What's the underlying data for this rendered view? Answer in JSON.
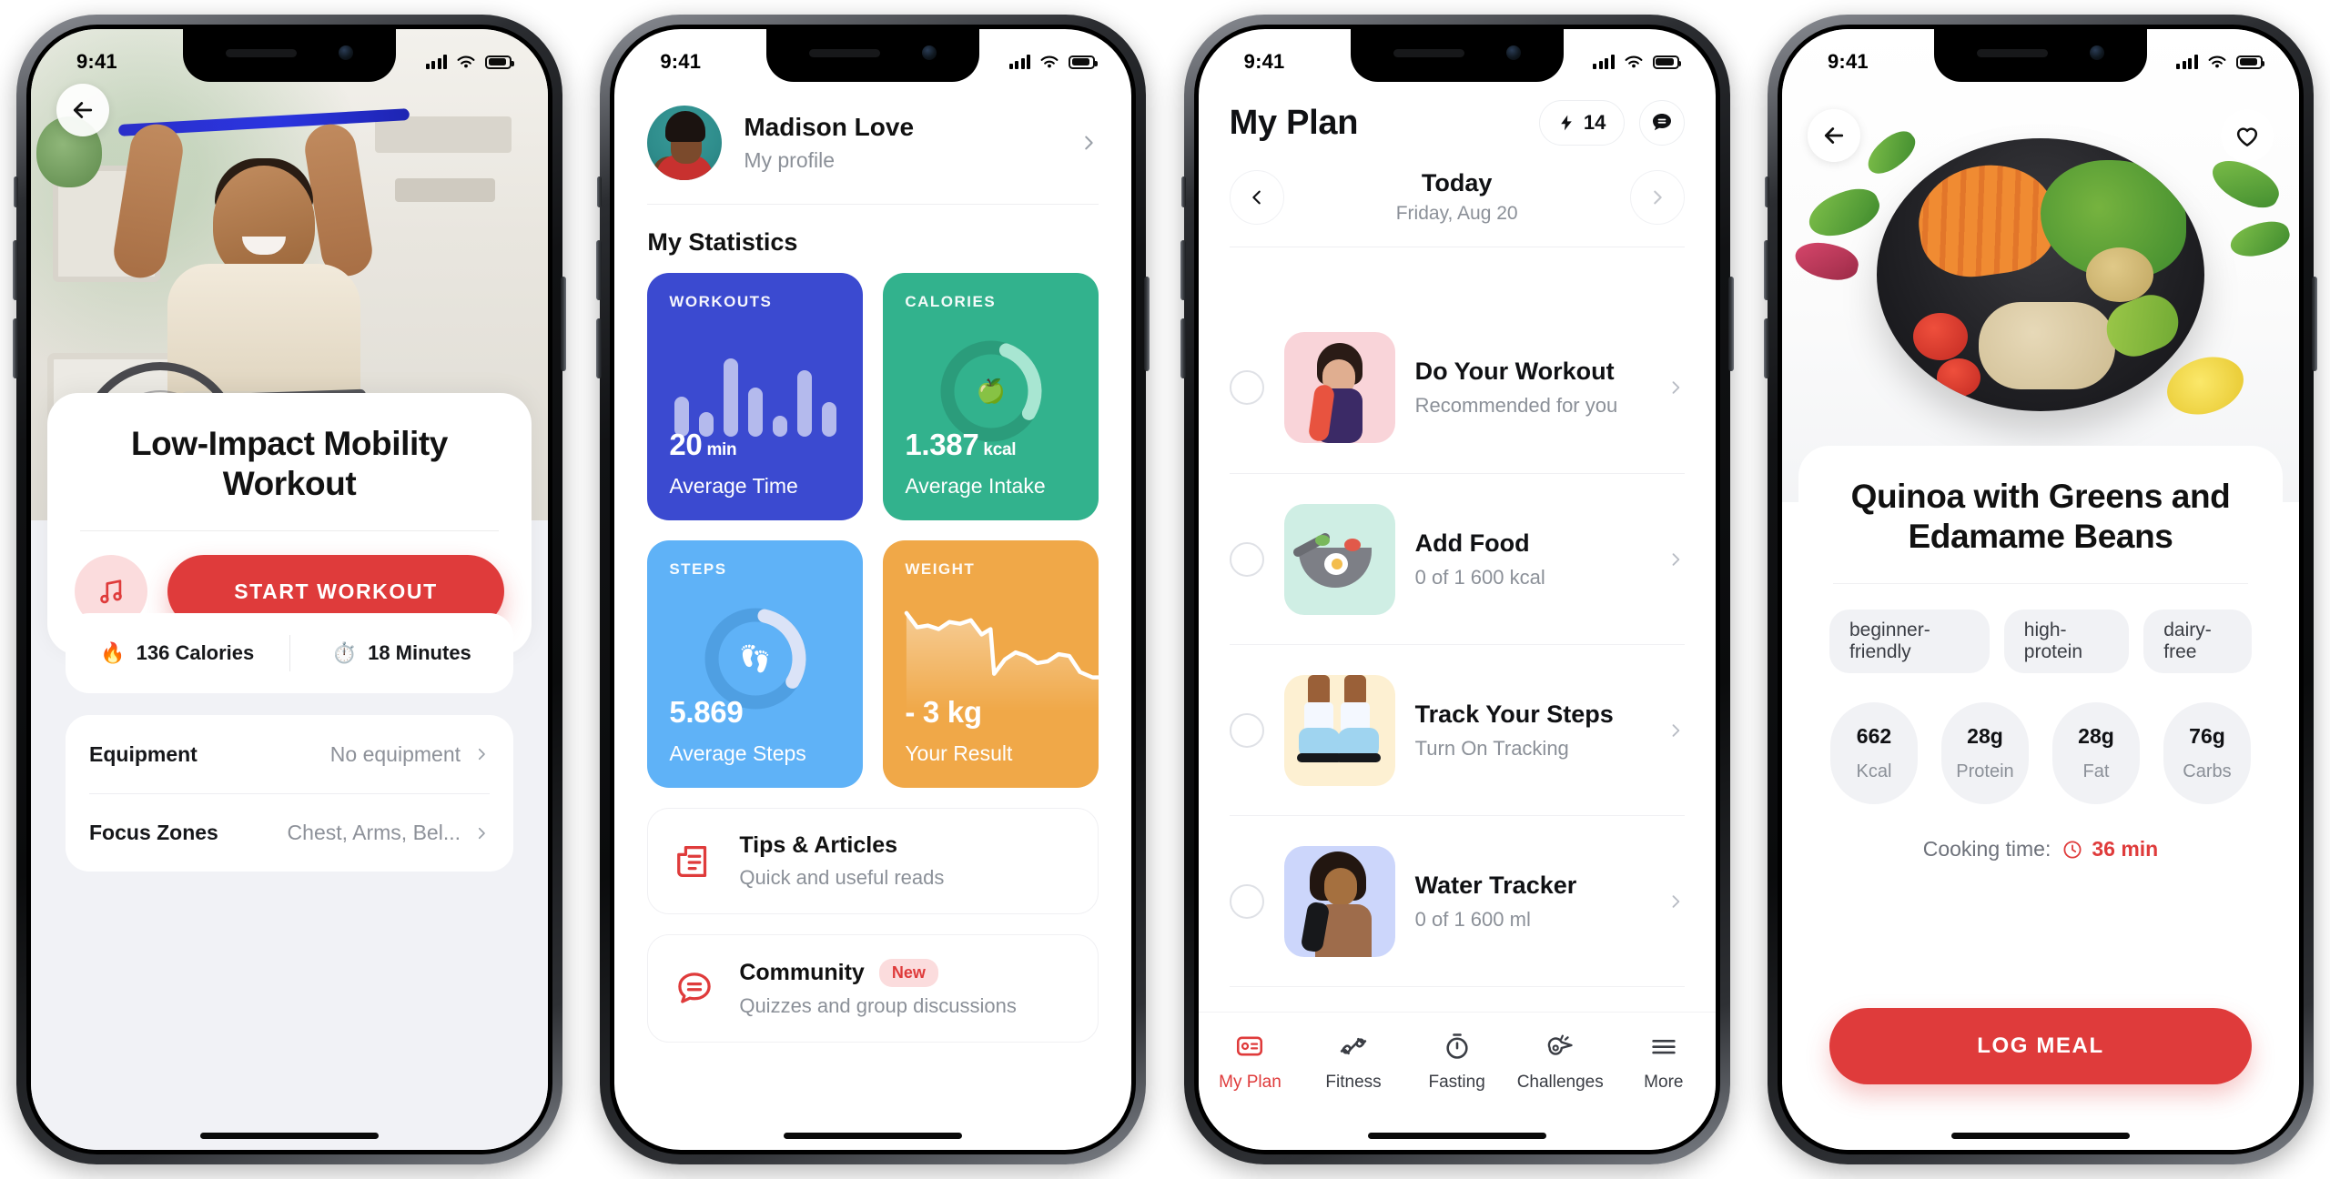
{
  "status_bar": {
    "time": "9:41"
  },
  "phone1": {
    "name": "workout-detail-screen",
    "back_icon": "arrow-left-icon",
    "title": "Low-Impact Mobility Workout",
    "music_icon": "music-note-icon",
    "start_label": "START WORKOUT",
    "stats": [
      {
        "icon": "fire-emoji",
        "glyph": "🔥",
        "text": "136 Calories"
      },
      {
        "icon": "stopwatch-emoji",
        "glyph": "⏱️",
        "text": "18 Minutes"
      }
    ],
    "rows": [
      {
        "label": "Equipment",
        "value": "No equipment"
      },
      {
        "label": "Focus Zones",
        "value": "Chest, Arms, Bel..."
      }
    ]
  },
  "phone2": {
    "name": "profile-statistics-screen",
    "profile": {
      "name": "Madison Love",
      "subtitle": "My profile",
      "chevron": "chevron-right-icon"
    },
    "section_title": "My Statistics",
    "cards": [
      {
        "label": "WORKOUTS",
        "value": "20",
        "unit": "min",
        "caption": "Average Time",
        "color": "#3b4ad0",
        "visual": "bar-chart"
      },
      {
        "label": "CALORIES",
        "value": "1.387",
        "unit": "kcal",
        "caption": "Average Intake",
        "color": "#32b28d",
        "visual": "progress-ring"
      },
      {
        "label": "STEPS",
        "value": "5.869",
        "unit": "",
        "caption": "Average Steps",
        "color": "#5fb2f7",
        "visual": "progress-ring"
      },
      {
        "label": "WEIGHT",
        "value": "- 3 kg",
        "unit": "",
        "caption": "Your Result",
        "color": "#f0a848",
        "visual": "area-line"
      }
    ],
    "links": [
      {
        "icon": "article-icon",
        "title": "Tips & Articles",
        "badge": "",
        "subtitle": "Quick and useful reads"
      },
      {
        "icon": "chat-bubble-icon",
        "title": "Community",
        "badge": "New",
        "subtitle": "Quizzes and group discussions"
      }
    ]
  },
  "phone3": {
    "name": "my-plan-screen",
    "title": "My Plan",
    "streak": {
      "icon": "lightning-bolt-icon",
      "count": "14"
    },
    "chat_icon": "chat-bubble-icon",
    "date_nav": {
      "prev_icon": "chevron-left-icon",
      "next_icon": "chevron-right-icon",
      "day": "Today",
      "date": "Friday, Aug 20"
    },
    "tasks": [
      {
        "title": "Do Your Workout",
        "subtitle": "Recommended for you",
        "thumb": "woman-with-resistance-band",
        "checked": false
      },
      {
        "title": "Add Food",
        "subtitle": "0 of 1 600 kcal",
        "thumb": "frying-pan-with-food",
        "checked": false
      },
      {
        "title": "Track Your Steps",
        "subtitle": "Turn On Tracking",
        "thumb": "sneakers",
        "checked": false
      },
      {
        "title": "Water Tracker",
        "subtitle": "0 of 1 600 ml",
        "thumb": "woman-with-bottle",
        "checked": false
      }
    ],
    "tabs": [
      {
        "label": "My Plan",
        "icon": "plan-card-icon",
        "active": true
      },
      {
        "label": "Fitness",
        "icon": "dumbbell-icon",
        "active": false
      },
      {
        "label": "Fasting",
        "icon": "stopwatch-icon",
        "active": false
      },
      {
        "label": "Challenges",
        "icon": "whistle-icon",
        "active": false
      },
      {
        "label": "More",
        "icon": "hamburger-menu-icon",
        "active": false
      }
    ]
  },
  "phone4": {
    "name": "recipe-detail-screen",
    "back_icon": "arrow-left-icon",
    "favorite_icon": "heart-icon",
    "title": "Quinoa with Greens and Edamame Beans",
    "tags": [
      "beginner-friendly",
      "high-protein",
      "dairy-free"
    ],
    "macros": [
      {
        "value": "662",
        "label": "Kcal"
      },
      {
        "value": "28g",
        "label": "Protein"
      },
      {
        "value": "28g",
        "label": "Fat"
      },
      {
        "value": "76g",
        "label": "Carbs"
      }
    ],
    "cooking_time": {
      "label": "Cooking time:",
      "icon": "clock-icon",
      "value": "36 min"
    },
    "log_label": "LOG MEAL"
  },
  "chart_data": [
    {
      "type": "bar",
      "title": "WORKOUTS",
      "categories": [
        "1",
        "2",
        "3",
        "4",
        "5",
        "6",
        "7"
      ],
      "values": [
        46,
        28,
        90,
        56,
        24,
        76,
        40
      ],
      "ylim": [
        0,
        100
      ],
      "series_color": "#ffffff"
    },
    {
      "type": "pie",
      "title": "CALORIES",
      "categories": [
        "progress",
        "remaining"
      ],
      "values": [
        28,
        72
      ],
      "ylim": [
        0,
        100
      ]
    },
    {
      "type": "pie",
      "title": "STEPS",
      "categories": [
        "progress",
        "remaining"
      ],
      "values": [
        30,
        70
      ],
      "ylim": [
        0,
        100
      ]
    },
    {
      "type": "area",
      "title": "WEIGHT",
      "x": [
        0,
        1,
        2,
        3,
        4,
        5,
        6,
        7,
        8,
        9,
        10,
        11,
        12,
        13,
        14,
        15,
        16,
        17,
        18
      ],
      "values": [
        95,
        86,
        83,
        86,
        85,
        86,
        84,
        74,
        78,
        42,
        46,
        62,
        58,
        52,
        50,
        56,
        60,
        48,
        36
      ],
      "ylim": [
        0,
        100
      ]
    }
  ],
  "colors": {
    "accent_red": "#df3b3b",
    "blue": "#3b4ad0",
    "green": "#32b28d",
    "light_blue": "#5fb2f7",
    "orange": "#f0a848",
    "muted_text": "#8b9098"
  }
}
